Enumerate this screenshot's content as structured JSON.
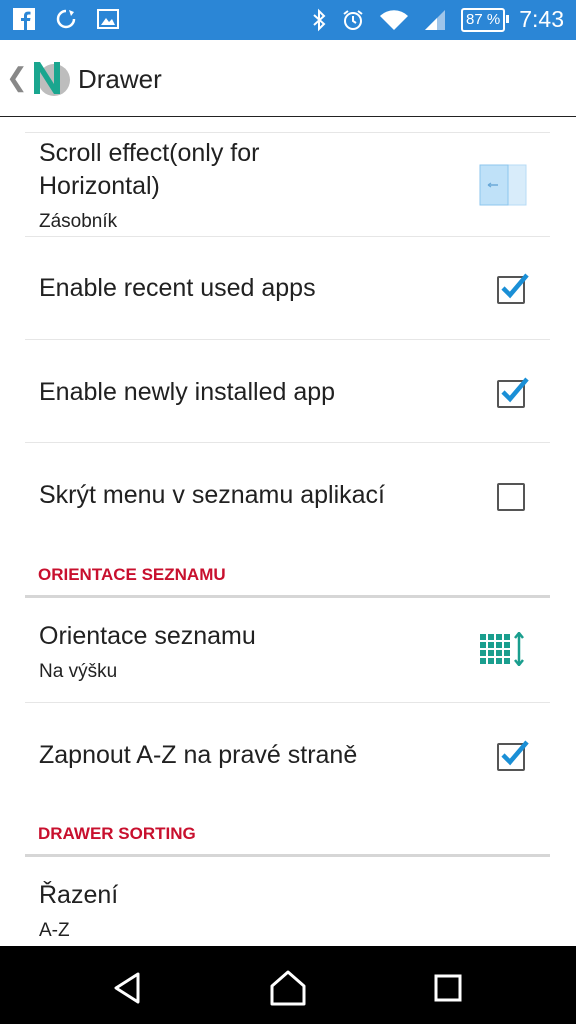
{
  "status_bar": {
    "time": "7:43",
    "battery": "87 %",
    "icons": [
      "facebook-icon",
      "sync-icon",
      "image-icon",
      "bluetooth-icon",
      "alarm-icon",
      "wifi-icon",
      "signal-icon"
    ]
  },
  "toolbar": {
    "title": "Drawer",
    "back_glyph": "❮"
  },
  "settings": {
    "scroll_effect": {
      "title": "Scroll effect(only for Horizontal)",
      "summary": "Zásobník"
    },
    "recent_apps": {
      "title": "Enable recent used apps",
      "checked": true
    },
    "newly_installed": {
      "title": "Enable newly installed app",
      "checked": true
    },
    "hide_menu": {
      "title": "Skrýt menu v seznamu aplikací",
      "checked": false
    },
    "section_orientation": "ORIENTACE SEZNAMU",
    "orientation": {
      "title": "Orientace seznamu",
      "summary": "Na výšku"
    },
    "az_right": {
      "title": "Zapnout A-Z na pravé straně",
      "checked": true
    },
    "section_sorting": "DRAWER SORTING",
    "sorting": {
      "title": "Řazení",
      "summary": "A-Z"
    }
  },
  "colors": {
    "status_bar": "#2b86d6",
    "accent_red": "#c8102e",
    "check_blue": "#1a8fd6",
    "teal": "#1a9e8e"
  }
}
